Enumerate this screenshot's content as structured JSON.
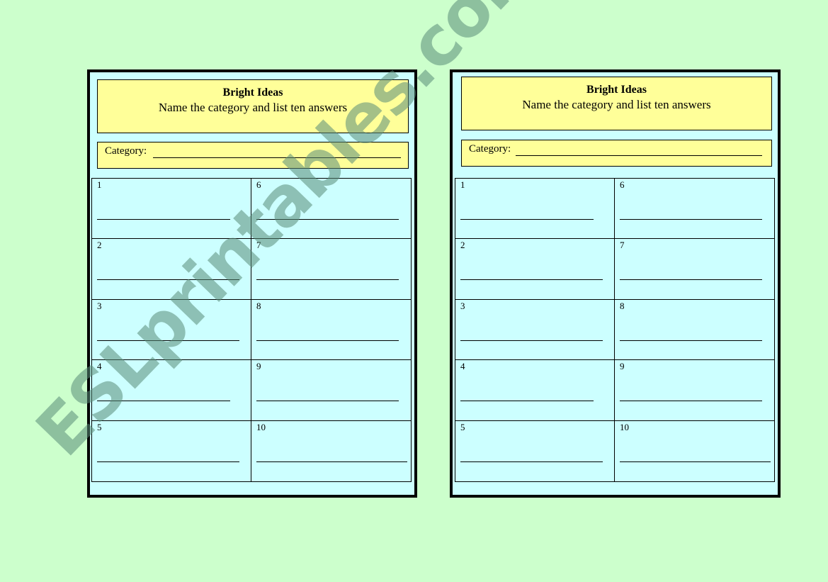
{
  "worksheets": [
    {
      "title": "Bright Ideas",
      "subtitle": "Name the category and list ten answers",
      "category_label": "Category:",
      "answers": [
        "1",
        "2",
        "3",
        "4",
        "5",
        "6",
        "7",
        "8",
        "9",
        "10"
      ]
    },
    {
      "title": "Bright Ideas",
      "subtitle": "Name the category and list ten answers",
      "category_label": "Category:",
      "answers": [
        "1",
        "2",
        "3",
        "4",
        "5",
        "6",
        "7",
        "8",
        "9",
        "10"
      ]
    }
  ],
  "watermark": "ESLprintables.com",
  "colors": {
    "background": "#ccffcc",
    "card": "#ccffff",
    "header": "#ffff99"
  }
}
